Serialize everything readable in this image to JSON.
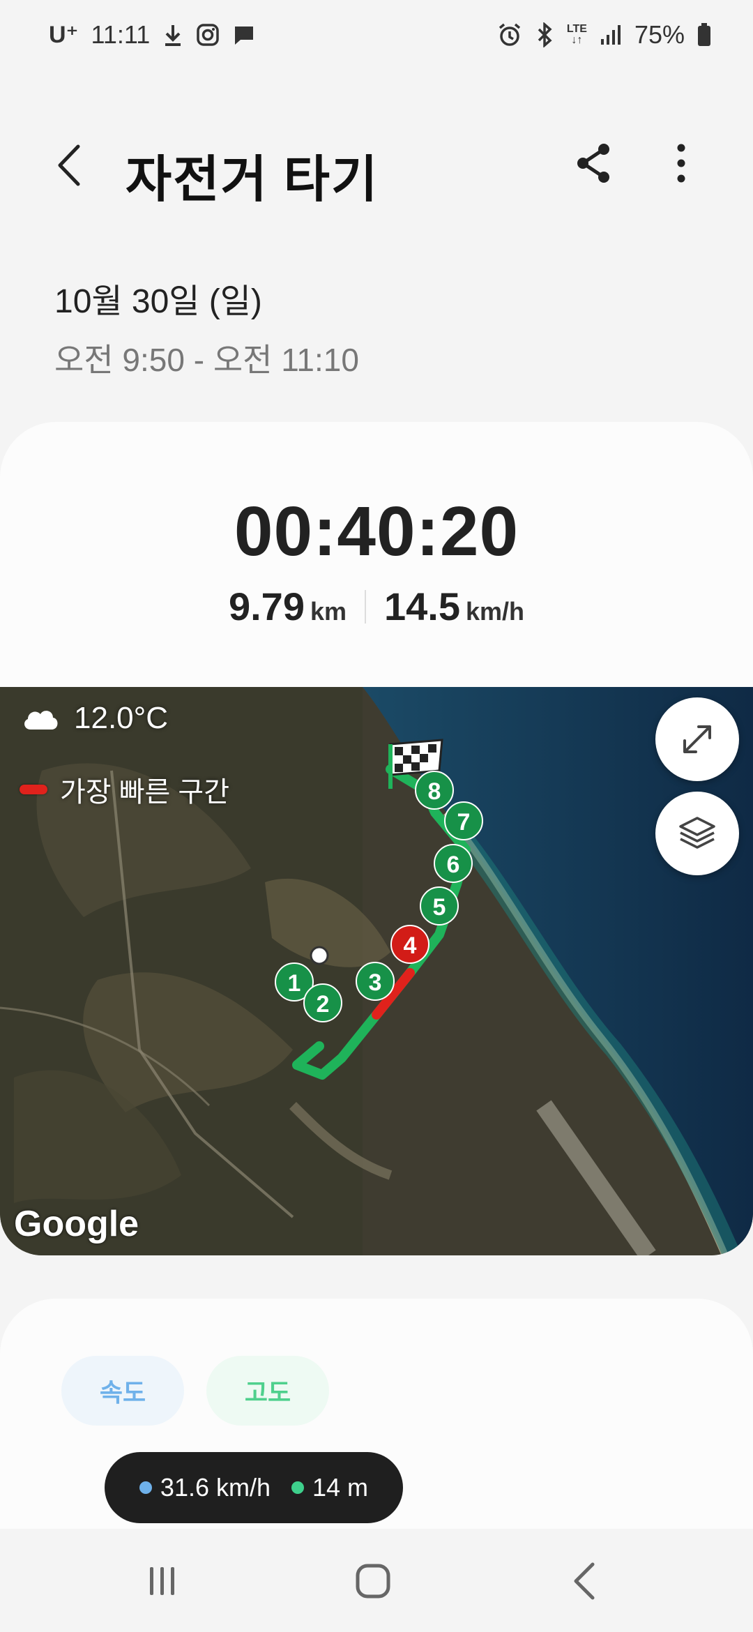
{
  "status_bar": {
    "carrier": "U⁺",
    "time": "11:11",
    "network": "LTE",
    "battery": "75%",
    "left_icons": [
      "download-icon",
      "instagram-icon",
      "message-icon"
    ],
    "right_icons": [
      "alarm-icon",
      "bluetooth-icon",
      "lte-icon",
      "signal-icon",
      "battery-icon"
    ]
  },
  "header": {
    "title": "자전거 타기"
  },
  "session": {
    "date": "10월 30일 (일)",
    "time_range": "오전 9:50 - 오전 11:10"
  },
  "summary": {
    "duration": "00:40:20",
    "distance_value": "9.79",
    "distance_unit": "km",
    "speed_value": "14.5",
    "speed_unit": "km/h"
  },
  "map": {
    "weather_icon": "cloud-icon",
    "temperature": "12.0°C",
    "legend_label": "가장 빠른 구간",
    "attribution": "Google",
    "route_color": "#1fb35a",
    "fastest_color": "#e0221c",
    "markers": [
      "1",
      "2",
      "3",
      "4",
      "5",
      "6",
      "7",
      "8"
    ],
    "fastest_marker": "4"
  },
  "chart_tabs": {
    "speed_label": "속도",
    "altitude_label": "고도"
  },
  "tooltip": {
    "speed": "31.6 km/h",
    "altitude": "14 m"
  },
  "colors": {
    "speed": "#6fb1ea",
    "altitude": "#3ed08c"
  }
}
